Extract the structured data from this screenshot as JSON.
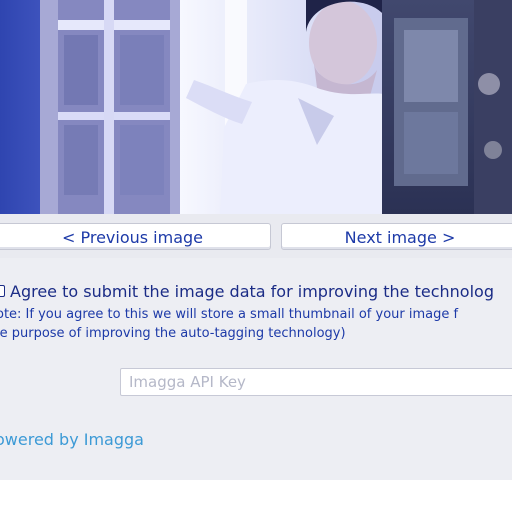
{
  "navigation": {
    "previous_label": "< Previous image",
    "next_label": "Next image >"
  },
  "consent": {
    "checked": false,
    "label": "Agree to submit the image data for improving the technolog",
    "note_line_1": "ote: If you agree to this we will store a small thumbnail of your image f",
    "note_line_2": "le purpose of improving the auto-tagging technology)"
  },
  "api_key": {
    "value": "",
    "placeholder": "Imagga API Key"
  },
  "footer": {
    "powered_by": "owered by Imagga"
  },
  "colors": {
    "primary_text": "#1b2c86",
    "link": "#3c9ad6",
    "panel_background": "#edeef3"
  }
}
